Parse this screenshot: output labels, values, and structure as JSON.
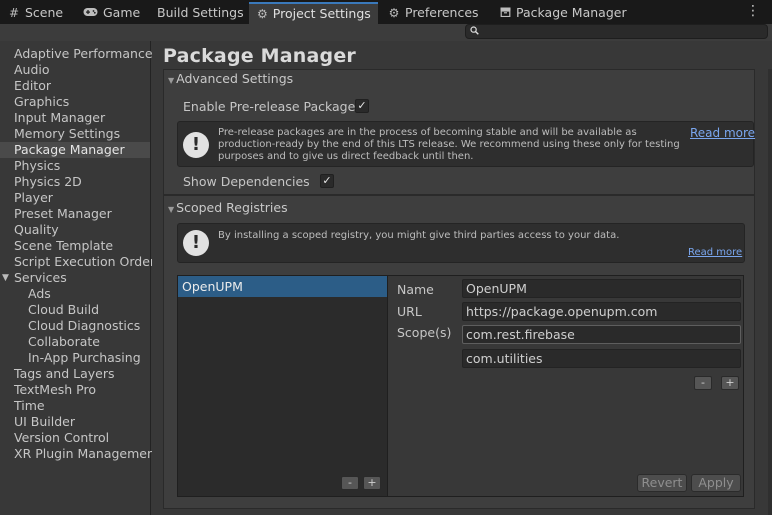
{
  "tabs": [
    {
      "label": "Scene",
      "icon": "grid-icon"
    },
    {
      "label": "Game",
      "icon": "gamepad-icon"
    },
    {
      "label": "Build Settings",
      "icon": ""
    },
    {
      "label": "Project Settings",
      "icon": "gear-icon"
    },
    {
      "label": "Preferences",
      "icon": "gear-icon"
    },
    {
      "label": "Package Manager",
      "icon": "package-icon"
    }
  ],
  "search": {
    "placeholder": ""
  },
  "sidebar": {
    "items": [
      {
        "label": "Adaptive Performance"
      },
      {
        "label": "Audio"
      },
      {
        "label": "Editor"
      },
      {
        "label": "Graphics"
      },
      {
        "label": "Input Manager"
      },
      {
        "label": "Memory Settings"
      },
      {
        "label": "Package Manager",
        "selected": true
      },
      {
        "label": "Physics"
      },
      {
        "label": "Physics 2D"
      },
      {
        "label": "Player"
      },
      {
        "label": "Preset Manager"
      },
      {
        "label": "Quality"
      },
      {
        "label": "Scene Template"
      },
      {
        "label": "Script Execution Order"
      },
      {
        "label": "Services",
        "expanded": true
      },
      {
        "label": "Ads",
        "child": true
      },
      {
        "label": "Cloud Build",
        "child": true
      },
      {
        "label": "Cloud Diagnostics",
        "child": true
      },
      {
        "label": "Collaborate",
        "child": true
      },
      {
        "label": "In-App Purchasing",
        "child": true
      },
      {
        "label": "Tags and Layers"
      },
      {
        "label": "TextMesh Pro"
      },
      {
        "label": "Time"
      },
      {
        "label": "UI Builder"
      },
      {
        "label": "Version Control"
      },
      {
        "label": "XR Plugin Management"
      }
    ]
  },
  "page": {
    "title": "Package Manager"
  },
  "advanced": {
    "header": "Advanced Settings",
    "prerelease_label": "Enable Pre-release Packages",
    "prerelease_checked": true,
    "help_text": "Pre-release packages are in the process of becoming stable and will be available as production-ready by the end of this LTS release. We recommend using these only for testing purposes and to give us direct feedback until then.",
    "read_more": "Read more",
    "show_deps_label": "Show Dependencies",
    "show_deps_checked": true
  },
  "scoped": {
    "header": "Scoped Registries",
    "help_text": "By installing a scoped registry, you might give third parties access to your data.",
    "read_more": "Read more",
    "registries": [
      "OpenUPM"
    ],
    "name_label": "Name",
    "name_value": "OpenUPM",
    "url_label": "URL",
    "url_value": "https://package.openupm.com",
    "scopes_label": "Scope(s)",
    "scopes": [
      "com.rest.firebase",
      "com.utilities"
    ],
    "minus": "-",
    "plus": "+",
    "revert_label": "Revert",
    "apply_label": "Apply"
  },
  "colors": {
    "accent": "#3a79bb",
    "selection": "#2c5d87",
    "link": "#7aa6ee"
  }
}
